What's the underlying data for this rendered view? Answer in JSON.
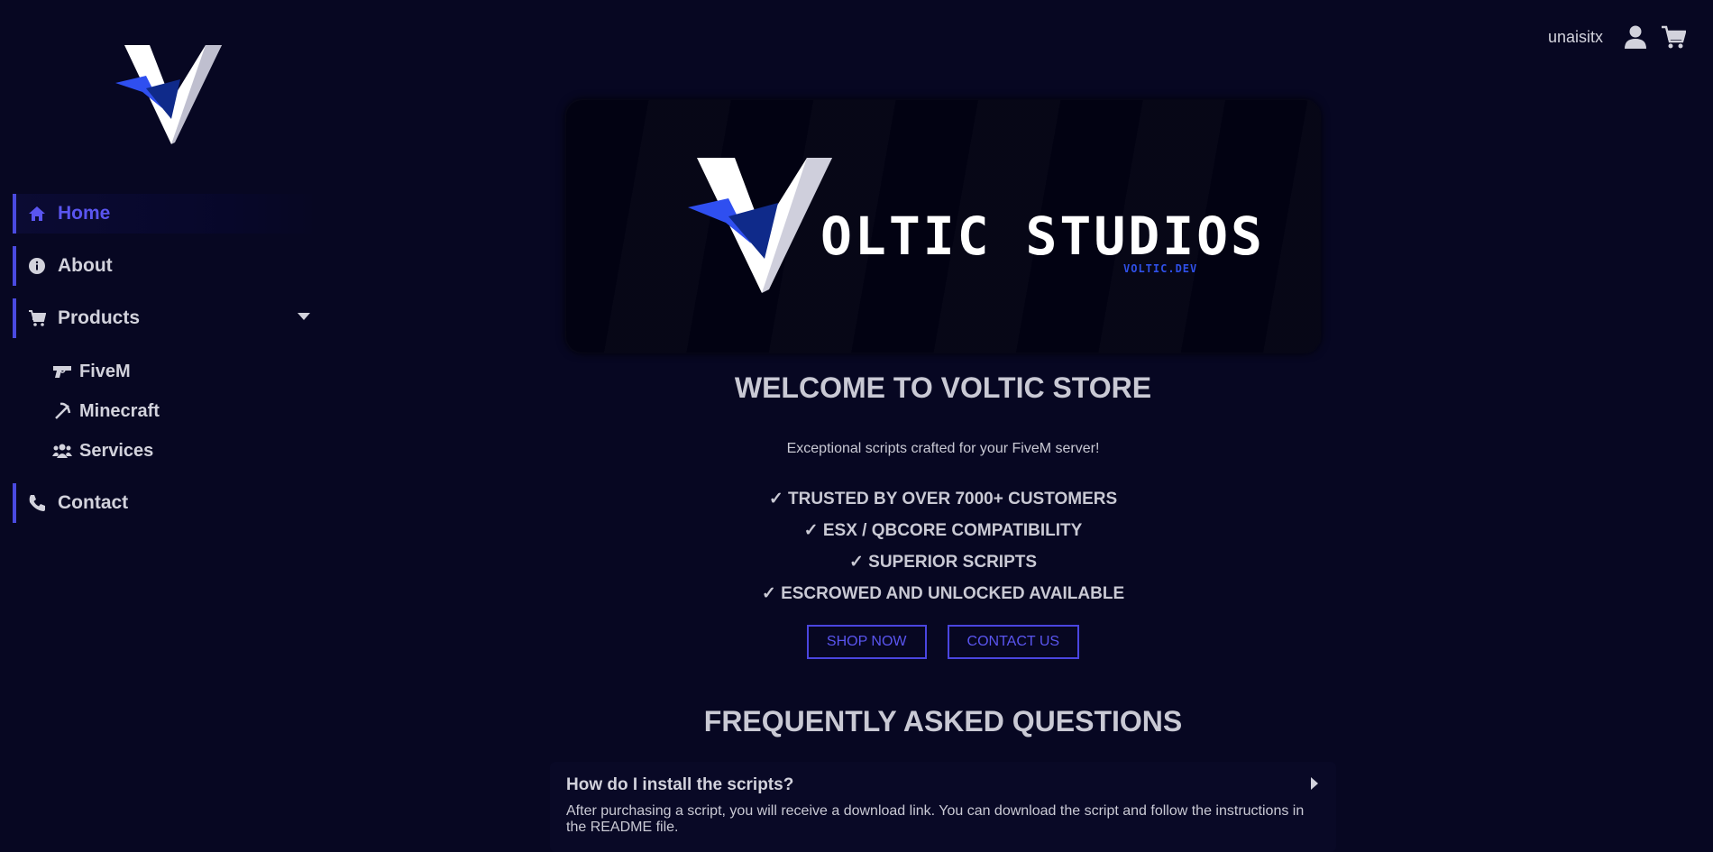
{
  "sidebar": {
    "logo_icon": "voltic-v-logo",
    "items": [
      {
        "label": "Home",
        "icon": "home-icon"
      },
      {
        "label": "About",
        "icon": "info-icon"
      },
      {
        "label": "Products",
        "icon": "cart-icon"
      },
      {
        "label": "Contact",
        "icon": "phone-icon"
      }
    ],
    "products_sub": [
      {
        "label": "FiveM",
        "icon": "gun-icon"
      },
      {
        "label": "Minecraft",
        "icon": "pickaxe-icon"
      },
      {
        "label": "Services",
        "icon": "users-icon"
      }
    ]
  },
  "topbar": {
    "username": "unaisitx",
    "user_icon": "user-icon",
    "cart_icon": "cart-icon"
  },
  "banner": {
    "title": "OLTIC STUDIOS",
    "subtitle": "VOLTIC.DEV"
  },
  "hero": {
    "title": "WELCOME TO VOLTIC STORE",
    "tagline": "Exceptional scripts crafted for your FiveM server!",
    "features": [
      "✓ TRUSTED BY OVER 7000+ CUSTOMERS",
      "✓ ESX / QBCORE COMPATIBILITY",
      "✓ SUPERIOR SCRIPTS",
      "✓ ESCROWED AND UNLOCKED AVAILABLE"
    ],
    "shop_button": "SHOP NOW",
    "contact_button": "CONTACT US"
  },
  "faq": {
    "title": "FREQUENTLY ASKED QUESTIONS",
    "items": [
      {
        "question": "How do I install the scripts?",
        "answer": "After purchasing a script, you will receive a download link. You can download the script and follow the instructions in the README file."
      }
    ]
  },
  "colors": {
    "background": "#070722",
    "accent": "#5a55f0",
    "text": "#c9c9d4"
  }
}
